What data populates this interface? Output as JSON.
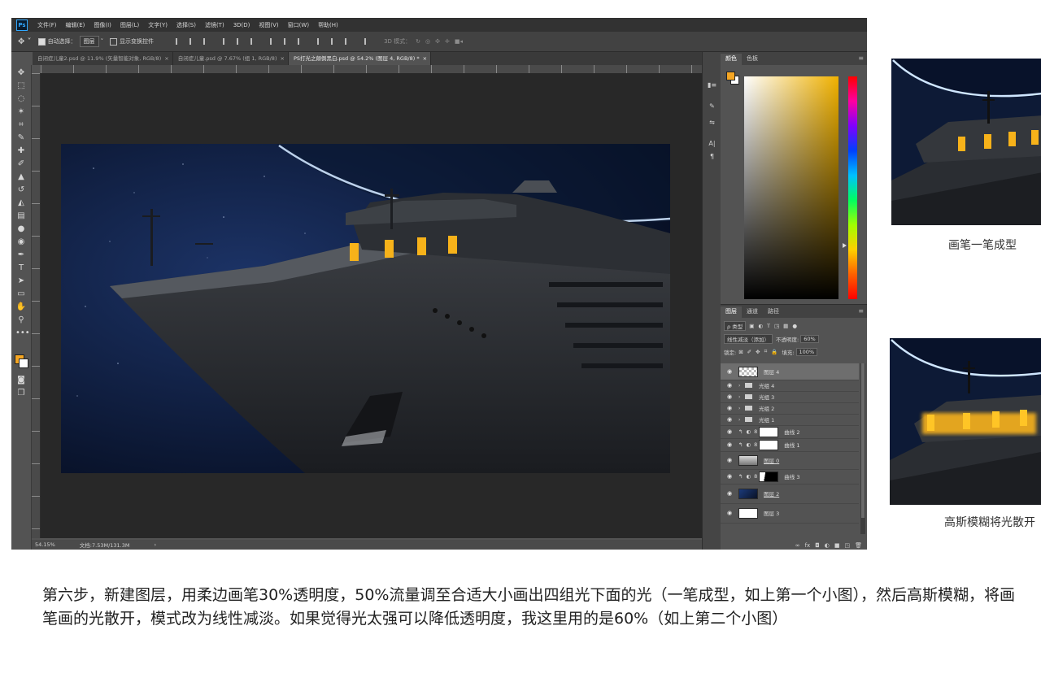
{
  "menu": {
    "logo": "Ps",
    "items": [
      "文件(F)",
      "编辑(E)",
      "图像(I)",
      "图层(L)",
      "文字(Y)",
      "选择(S)",
      "滤镜(T)",
      "3D(D)",
      "视图(V)",
      "窗口(W)",
      "帮助(H)"
    ]
  },
  "options": {
    "auto_select_label": "自动选择：",
    "auto_select_value": "图层",
    "show_transform_label": "显示变换控件",
    "mode_label": "3D 模式："
  },
  "tabs": [
    {
      "label": "自闭症儿童2.psd @ 11.9% (矢量智能对象, RGB/8)",
      "close": "×"
    },
    {
      "label": "自闭症儿童.psd @ 7.67% (组 1, RGB/8)",
      "close": "×"
    },
    {
      "label": "PS打光之颠倒黑白.psd @ 54.2% (图层 4, RGB/8) *",
      "close": "×"
    }
  ],
  "status": {
    "zoom": "54.15%",
    "doc": "文档:7.53M/131.3M",
    "arrow": "›"
  },
  "color_panel": {
    "tabs": [
      "颜色",
      "色板"
    ],
    "fg_color": "#f5a623"
  },
  "layers_panel": {
    "tabs": [
      "图层",
      "通道",
      "路径"
    ],
    "kind_label": "ρ 类型",
    "blend_mode": "线性减淡（添加）",
    "opacity_label": "不透明度:",
    "opacity_value": "60%",
    "lock_label": "锁定:",
    "fill_label": "填充:",
    "fill_value": "100%",
    "layers": [
      {
        "name": "图层 4",
        "kind": "pixel",
        "selected": true
      },
      {
        "name": "光组 4",
        "kind": "group"
      },
      {
        "name": "光组 3",
        "kind": "group"
      },
      {
        "name": "光组 2",
        "kind": "group"
      },
      {
        "name": "光组 1",
        "kind": "group"
      },
      {
        "name": "曲线 2",
        "kind": "adjust-white"
      },
      {
        "name": "曲线 1",
        "kind": "adjust-white"
      },
      {
        "name": "图层 0",
        "kind": "ship"
      },
      {
        "name": "曲线 3",
        "kind": "adjust-black"
      },
      {
        "name": "图层 2",
        "kind": "space"
      },
      {
        "name": "图层 3",
        "kind": "white"
      }
    ],
    "footer_icons": [
      "∞",
      "fx",
      "◘",
      "◐",
      "■",
      "◳",
      "🗑"
    ]
  },
  "right_thumbs": {
    "caption_1": "画笔一笔成型",
    "caption_2": "高斯模糊将光散开"
  },
  "body_text": "第六步，新建图层，用柔边画笔30%透明度，50%流量调至合适大小画出四组光下面的光（一笔成型，如上第一个小图），然后高斯模糊，将画笔画的光散开，模式改为线性减淡。如果觉得光太强可以降低透明度，我这里用的是60%（如上第二个小图）"
}
